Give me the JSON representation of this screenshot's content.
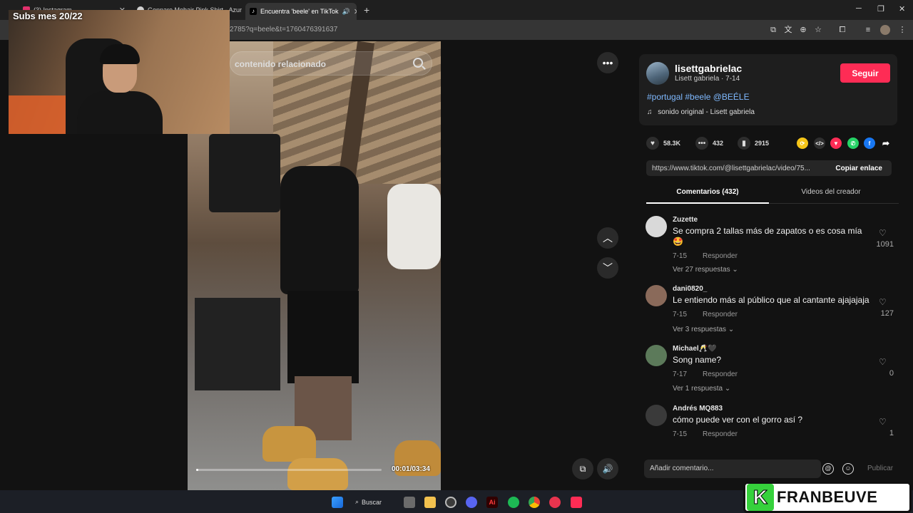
{
  "browser": {
    "tabs": [
      {
        "label": "(3) Instagram",
        "favicon_color": "#e1306c"
      },
      {
        "label": "Gennaro Mohair Pink Shirt - Azur",
        "favicon_color": "#cfcfcf"
      },
      {
        "label": "Encuentra 'beele' en TikTok",
        "favicon_color": "#ffffff"
      }
    ],
    "url": "2785?q=beele&t=1760476391637"
  },
  "overlay": {
    "subs_counter": "Subs mes 20/22",
    "brand_letter": "K",
    "brand_name": "FRANBEUVE"
  },
  "video": {
    "search_placeholder": "contenido relacionado",
    "timecode": "00:01/03:34",
    "progress": 0.005
  },
  "post": {
    "username": "lisettgabrielac",
    "nick_date": "Lisett gabriela · 7-14",
    "follow_label": "Seguir",
    "hashtags": "#portugal #beele @BEÉLE",
    "sound": "sonido original - Lisett gabriela",
    "likes": "58.3K",
    "comments": "432",
    "saves": "2915",
    "link": "https://www.tiktok.com/@lisettgabrielac/video/75...",
    "copy_label": "Copiar enlace",
    "tab_comments": "Comentarios (432)",
    "tab_creator": "Videos del creador"
  },
  "comments": [
    {
      "name": "Zuzette",
      "text": "Se compra 2 tallas más de zapatos o es cosa mía 🤩",
      "date": "7-15",
      "reply": "Responder",
      "replies": "Ver 27 respuestas",
      "likes": "1091",
      "avatar_color": "#d9d9d9"
    },
    {
      "name": "dani0820_",
      "text": "Le entiendo más al público que al cantante ajajajaja",
      "date": "7-15",
      "reply": "Responder",
      "replies": "Ver 3 respuestas",
      "likes": "127",
      "avatar_color": "#8a6a5a"
    },
    {
      "name": "Michael🥂🖤",
      "text": "Song name?",
      "date": "7-17",
      "reply": "Responder",
      "replies": "Ver 1 respuesta",
      "likes": "0",
      "avatar_color": "#5c7a5a"
    },
    {
      "name": "Andrés MQ883",
      "text": "cómo puede ver con el gorro así ?",
      "date": "7-15",
      "reply": "Responder",
      "replies": "",
      "likes": "1",
      "avatar_color": "#3a3a3a"
    }
  ],
  "composer": {
    "placeholder": "Añadir comentario...",
    "publish_label": "Publicar"
  },
  "taskbar": {
    "search_label": "Buscar"
  },
  "colors": {
    "accent": "#fe2c55",
    "hashtag": "#7fb9ff",
    "background": "#121212"
  }
}
